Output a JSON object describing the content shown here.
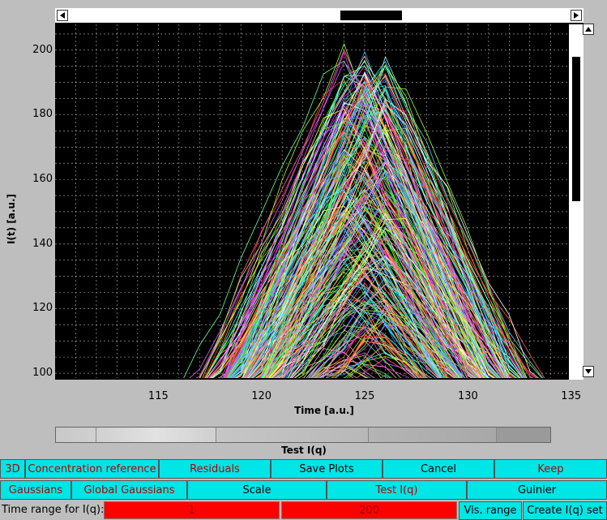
{
  "chart_data": {
    "type": "line",
    "xlabel": "Time [a.u.]",
    "ylabel": "I(t) [a.u.]",
    "xlim": [
      110,
      135.6
    ],
    "ylim": [
      98,
      208
    ],
    "xticks": [
      "115",
      "120",
      "125",
      "130",
      "135"
    ],
    "yticks": [
      "100",
      "120",
      "140",
      "160",
      "180",
      "200"
    ],
    "grid": true,
    "background": "#000000",
    "series_count": 250,
    "peak_time": 125,
    "peak_max": 203,
    "note_on_shape": "many overlapping triangular peaked curves centred near t=125"
  },
  "slider": {
    "label": "Test I(q)"
  },
  "buttons_row1": [
    {
      "label": "3D",
      "black": false
    },
    {
      "label": "Concentration reference",
      "black": false
    },
    {
      "label": "Residuals",
      "black": false
    },
    {
      "label": "Save Plots",
      "black": true
    },
    {
      "label": "Cancel",
      "black": true
    },
    {
      "label": "Keep",
      "black": false
    }
  ],
  "buttons_row2": [
    {
      "label": "Gaussians",
      "black": false
    },
    {
      "label": "Global Gaussians",
      "black": false
    },
    {
      "label": "Scale",
      "black": true
    },
    {
      "label": "Test I(q)",
      "black": false
    },
    {
      "label": "Guinier",
      "black": true
    }
  ],
  "row3": {
    "label": "Time range for I(q):",
    "from": "1",
    "to": "200",
    "vis_range": "Vis. range",
    "create_set": "Create I(q) set"
  },
  "colors": {
    "button": "#00e5e5",
    "button_text": "#b50000",
    "field": "#ff0000",
    "window_bg": "#bebebe"
  }
}
